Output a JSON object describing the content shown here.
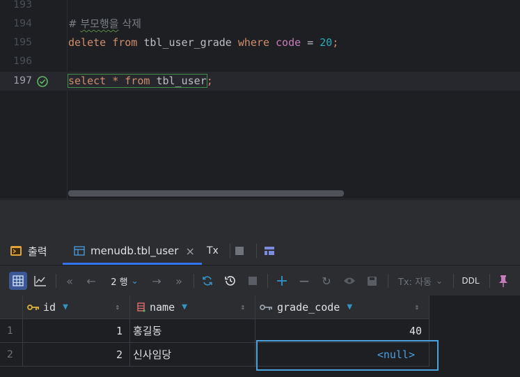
{
  "editor": {
    "lines": [
      {
        "number": "193",
        "text": ""
      },
      {
        "number": "194",
        "comment_prefix": "#",
        "comment_word": "부모행을",
        "comment_rest": "삭제"
      },
      {
        "number": "195",
        "kw1": "delete",
        "kw2": "from",
        "table": "tbl_user_grade",
        "kw3": "where",
        "column": "code",
        "op": "=",
        "value": "20",
        "semi": ";"
      },
      {
        "number": "196",
        "text": ""
      },
      {
        "number": "197",
        "kw1": "select",
        "star": "*",
        "kw2": "from",
        "table": "tbl_user",
        "semi": ";"
      }
    ]
  },
  "tabs": {
    "output": "출력",
    "table": "menudb.tbl_user",
    "close": "×",
    "tx": "Tx"
  },
  "toolbar": {
    "rows_label": "2 행",
    "tx_mode": "Tx: 자동",
    "ddl": "DDL"
  },
  "grid": {
    "columns": [
      "id",
      "name",
      "grade_code"
    ],
    "rows": [
      {
        "row": "1",
        "id": "1",
        "name": "홍길동",
        "grade_code": "40"
      },
      {
        "row": "2",
        "id": "2",
        "name": "신사임당",
        "grade_code": "<null>"
      }
    ]
  },
  "colors": {
    "accent": "#3574f0",
    "keyword": "#cf8e6d",
    "number": "#2aacb8",
    "null": "#4d9fe0"
  }
}
